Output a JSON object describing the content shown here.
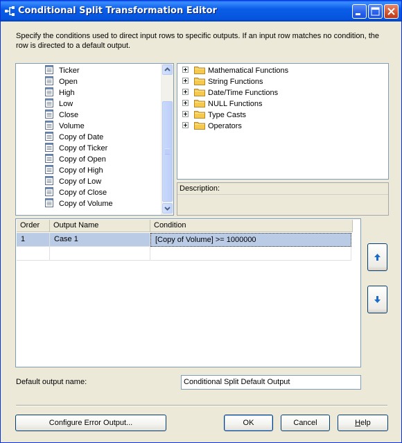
{
  "window": {
    "title": "Conditional Split Transformation Editor",
    "title_icon": "conditional-split-icon"
  },
  "intro_text": "Specify the conditions used to direct input rows to specific outputs. If an input row matches no condition, the row is directed to a default output.",
  "columns_tree": {
    "items": [
      {
        "label": "Ticker",
        "icon": "column-icon"
      },
      {
        "label": "Open",
        "icon": "column-icon"
      },
      {
        "label": "High",
        "icon": "column-icon"
      },
      {
        "label": "Low",
        "icon": "column-icon"
      },
      {
        "label": "Close",
        "icon": "column-icon"
      },
      {
        "label": "Volume",
        "icon": "column-icon"
      },
      {
        "label": "Copy of Date",
        "icon": "column-icon"
      },
      {
        "label": "Copy of Ticker",
        "icon": "column-icon"
      },
      {
        "label": "Copy of Open",
        "icon": "column-icon"
      },
      {
        "label": "Copy of High",
        "icon": "column-icon"
      },
      {
        "label": "Copy of Low",
        "icon": "column-icon"
      },
      {
        "label": "Copy of Close",
        "icon": "column-icon"
      },
      {
        "label": "Copy of Volume",
        "icon": "column-icon"
      }
    ]
  },
  "functions_tree": {
    "items": [
      {
        "label": "Mathematical Functions",
        "icon": "folder-icon"
      },
      {
        "label": "String Functions",
        "icon": "folder-icon"
      },
      {
        "label": "Date/Time Functions",
        "icon": "folder-icon"
      },
      {
        "label": "NULL Functions",
        "icon": "folder-icon"
      },
      {
        "label": "Type Casts",
        "icon": "folder-icon"
      },
      {
        "label": "Operators",
        "icon": "folder-icon"
      }
    ]
  },
  "description": {
    "label": "Description:",
    "text": ""
  },
  "conditions_grid": {
    "headers": [
      "Order",
      "Output Name",
      "Condition"
    ],
    "rows": [
      {
        "order": "1",
        "output_name": "Case 1",
        "condition": "[Copy of Volume] >= 1000000"
      },
      {
        "order": "",
        "output_name": "",
        "condition": ""
      }
    ]
  },
  "default_output": {
    "label": "Default output name:",
    "value": "Conditional Split Default Output"
  },
  "buttons": {
    "configure_error": "Configure Error Output...",
    "ok": "OK",
    "cancel": "Cancel",
    "help": "Help"
  },
  "colors": {
    "titlebar": "#0a5de8",
    "dialog_bg": "#ece9d8",
    "selected_row": "#bacbe6",
    "folder": "#f5c94b"
  }
}
